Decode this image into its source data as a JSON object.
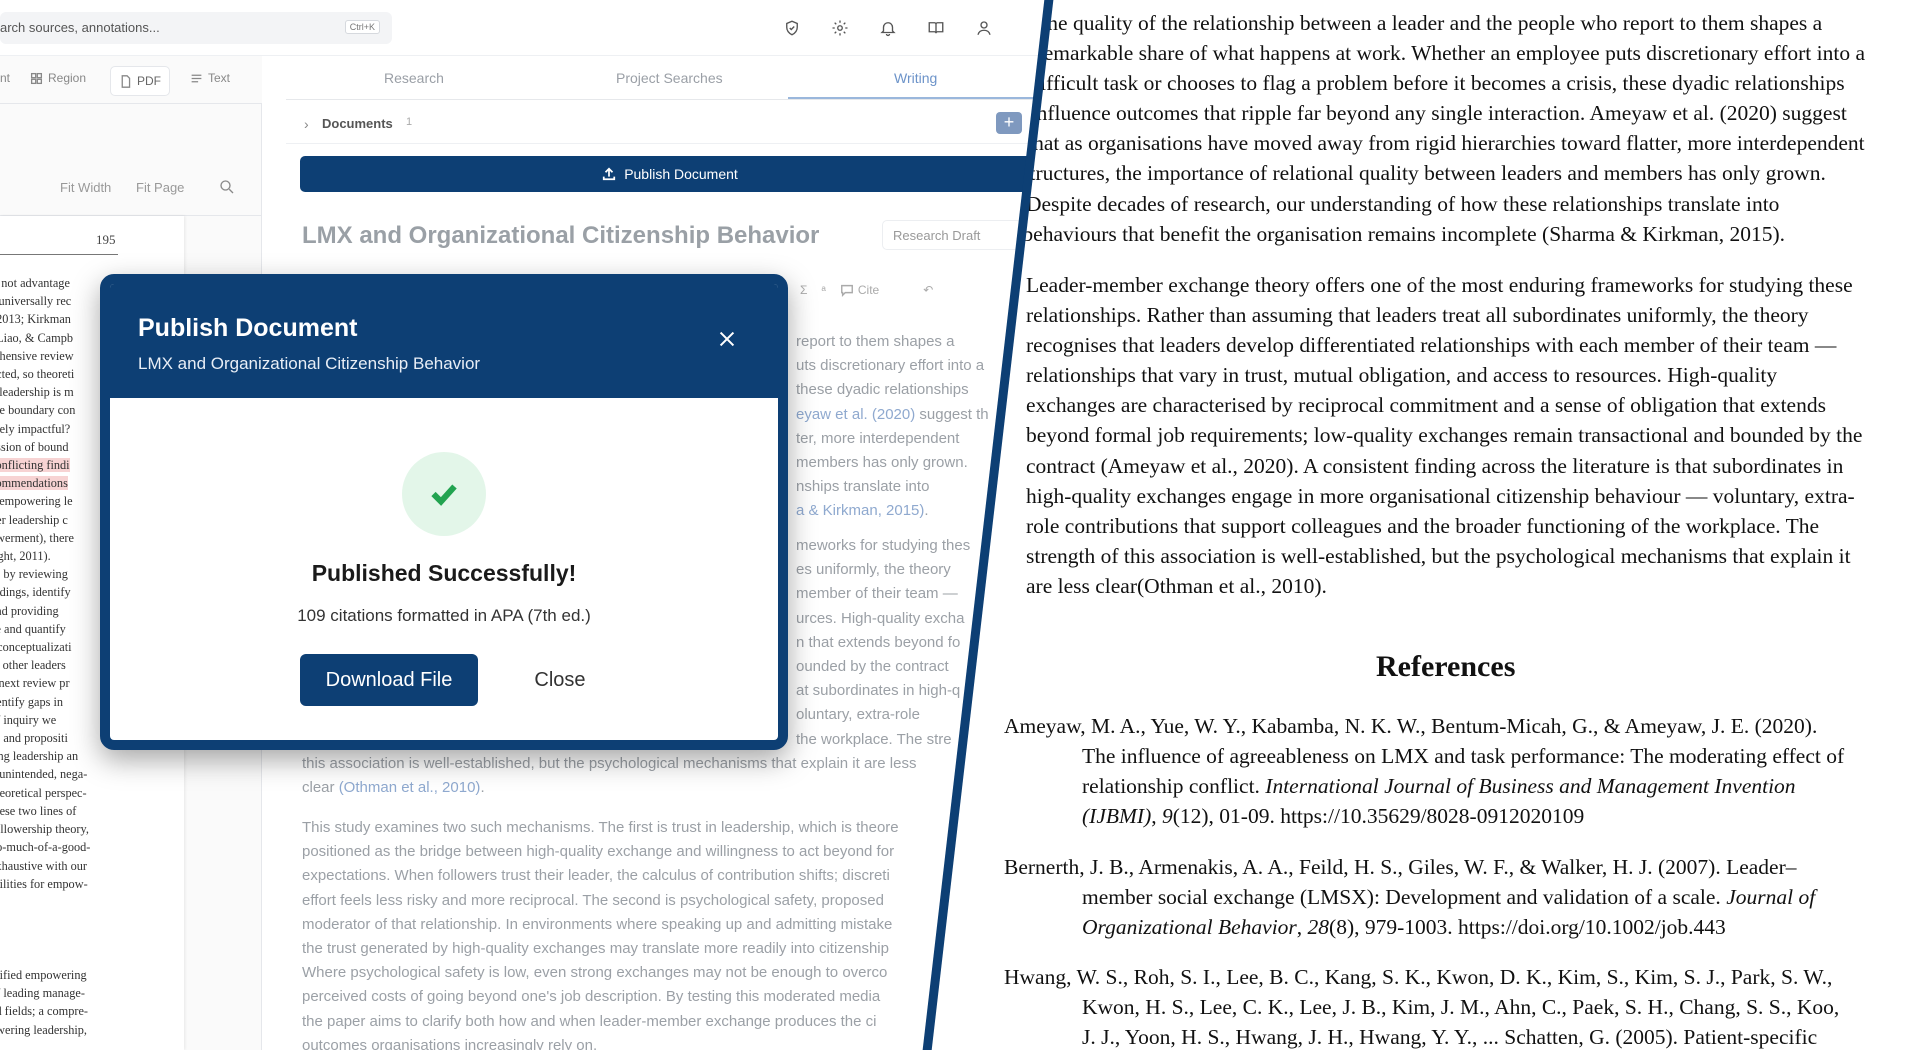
{
  "topbar": {
    "search_placeholder": "arch sources, annotations...",
    "search_shortcut": "Ctrl+K"
  },
  "pdf_viewer": {
    "toolbar": {
      "prev_partial": "nt",
      "region": "Region",
      "pdf": "PDF",
      "text": "Text"
    },
    "zoom": {
      "fit_width": "Fit Width",
      "fit_page": "Fit Page"
    },
    "page_number": "195",
    "lines_top": [
      "is not advantage",
      "e universally rec",
      ", 2013; Kirkman",
      ", Liao, & Campb",
      "rehensive review",
      "ucted, so theoreti",
      "g leadership is m",
      "ere boundary con",
      "ively impactful?",
      "ussion of bound",
      "conflicting findi",
      "commendations",
      "d empowering le",
      "her leadership c",
      "owerment), there",
      "right, 2011).",
      "es by reviewing",
      "indings, identify",
      " and providing",
      "ze and quantify",
      "r conceptualizati",
      "m other leaders",
      "e next review pr",
      "dentify gaps in",
      " of inquiry we",
      " 1) and propositi",
      "ring leadership an",
      "d unintended, nega-",
      "theoretical perspec-",
      " these two lines of",
      "followership theory,",
      "oo-much-of-a-good-",
      "exhaustive with our",
      "ibilities for empow-"
    ],
    "lines_bottom": [
      "ntified empowering",
      " of leading manage-",
      "ed fields; a compre-",
      "owering leadership,"
    ]
  },
  "writing": {
    "tabs": [
      "Research",
      "Project Searches",
      "Writing"
    ],
    "active_tab": "Writing",
    "documents_label": "Documents",
    "documents_count": "1",
    "publish_bar_label": "Publish Document",
    "doc_title": "LMX and Organizational Citizenship Behavior",
    "draft_select": "Research Draft",
    "toolbar": {
      "sigma": "Σ",
      "cite": "Cite"
    },
    "p1_lines": [
      {
        "t": "report to them shapes a"
      },
      {
        "t": "uts discretionary effort into a"
      },
      {
        "t": "these dyadic relationships"
      },
      {
        "t": "eyaw et al. (2020)",
        "cit": true,
        "after": "  suggest th"
      },
      {
        "t": "ter, more interdependent"
      },
      {
        "t": "members has only grown."
      },
      {
        "t": "nships translate into"
      },
      {
        "t": "a & Kirkman, 2015)",
        "cit": true,
        "after": "."
      }
    ],
    "p2_lines": [
      {
        "t": "meworks for studying thes"
      },
      {
        "t": "es uniformly, the theory"
      },
      {
        "t": "member of their team —"
      },
      {
        "t": "urces. High-quality excha"
      },
      {
        "t": "n that extends beyond fo"
      },
      {
        "t": "ounded by the contract"
      },
      {
        "t": "at subordinates in high-q"
      },
      {
        "t": "oluntary, extra-role"
      },
      {
        "t": "the workplace. The stre"
      }
    ],
    "p2_tail": "this association is well-established, but the psychological mechanisms that explain it are less",
    "p2_tail2_pre": "clear ",
    "p2_tail2_cit": "(Othman et al., 2010)",
    "p2_tail2_post": ".",
    "p3_lines": [
      "This study examines two such mechanisms. The first is trust in leadership, which is theore",
      "positioned as the bridge between high-quality exchange and willingness to act beyond for",
      "expectations. When followers trust their leader, the calculus of contribution shifts; discreti",
      "effort feels less risky and more reciprocal. The second is psychological safety, proposed",
      "moderator of that relationship. In environments where speaking up and admitting mistake",
      "the trust generated by high-quality exchanges may translate more readily into citizenship",
      "Where psychological safety is low, even strong exchanges may not be enough to overco",
      "perceived costs of going beyond one's job description. By testing this moderated media",
      "the paper aims to clarify both how and when leader-member exchange produces the ci",
      "outcomes organisations increasingly rely on."
    ]
  },
  "modal": {
    "title": "Publish Document",
    "subtitle": "LMX and Organizational Citizenship Behavior",
    "success_title": "Published Successfully!",
    "success_sub": "109 citations formatted in APA (7th ed.)",
    "download_label": "Download File",
    "close_label": "Close"
  },
  "paper": {
    "p1_lines": [
      "he quality of the relationship between a leader and the people who report to them shapes a",
      "emarkable share of what happens at work. Whether an employee puts discretionary effort into a",
      "ifficult task or chooses to flag a problem before it becomes a crisis, these dyadic relationships",
      "nfluence outcomes that ripple far beyond any single interaction. Ameyaw et al. (2020) suggest",
      "hat as organisations have moved away from rigid hierarchies toward flatter, more interdependent",
      "tructures, the importance of relational quality between leaders and members has only grown.",
      "Despite decades of research, our understanding of how these relationships translate into",
      "behaviours that benefit the organisation remains incomplete (Sharma & Kirkman, 2015)."
    ],
    "p2_lines": [
      "Leader-member exchange theory offers one of the most enduring frameworks for studying these",
      "relationships. Rather than assuming that leaders treat all subordinates uniformly, the theory",
      "recognises that leaders develop differentiated relationships with each member of their team —",
      "relationships that vary in trust, mutual obligation, and access to resources. High-quality",
      "exchanges are characterised by reciprocal commitment and a sense of obligation that extends",
      "beyond formal job requirements; low-quality exchanges remain transactional and bounded by the",
      "contract (Ameyaw et al., 2020). A consistent finding across the literature is that subordinates in",
      "high-quality exchanges engage in more organisational citizenship behaviour — voluntary, extra-",
      "role contributions that support colleagues and the broader functioning of the workplace. The",
      "strength of this association is well-established, but the psychological mechanisms that explain it",
      "are less clear(Othman et al., 2010)."
    ],
    "references_heading": "References",
    "ref1": {
      "l1": "Ameyaw, M. A., Yue, W. Y., Kabamba, N. K. W., Bentum-Micah, G., & Ameyaw, J. E. (2020).",
      "l2": "The influence of agreeableness on LMX and task performance: The moderating effect of",
      "l3_pre": "relationship conflict. ",
      "l3_it": "International Journal of Business and Management Invention",
      "l4_it": "(IJBMI)",
      "l4_mid": ", ",
      "l4_it2": "9",
      "l4_post": "(12), 01-09. https://10.35629/8028-0912020109"
    },
    "ref2": {
      "l1": "Bernerth, J. B., Armenakis, A. A., Feild, H. S., Giles, W. F., & Walker, H. J. (2007). Leader–",
      "l2_pre": "member social exchange (LMSX): Development and validation of a scale. ",
      "l2_it": "Journal of",
      "l3_it": "Organizational Behavior",
      "l3_mid": ", ",
      "l3_it2": "28",
      "l3_post": "(8), 979-1003. https://doi.org/10.1002/job.443"
    },
    "ref3": {
      "l1": "Hwang, W. S., Roh, S. I., Lee, B. C., Kang, S. K., Kwon, D. K., Kim, S., Kim, S. J., Park, S. W.,",
      "l2": "Kwon, H. S., Lee, C. K., Lee, J. B., Kim, J. M., Ahn, C., Paek, S. H., Chang, S. S., Koo,",
      "l3": "J. J., Yoon, H. S., Hwang, J. H., Hwang, Y. Y., ... Schatten, G. (2005). Patient-specific"
    }
  },
  "colors": {
    "brand_navy": "#0d3f74",
    "success_green": "#22a350",
    "citation_blue": "#8fa9cf"
  }
}
